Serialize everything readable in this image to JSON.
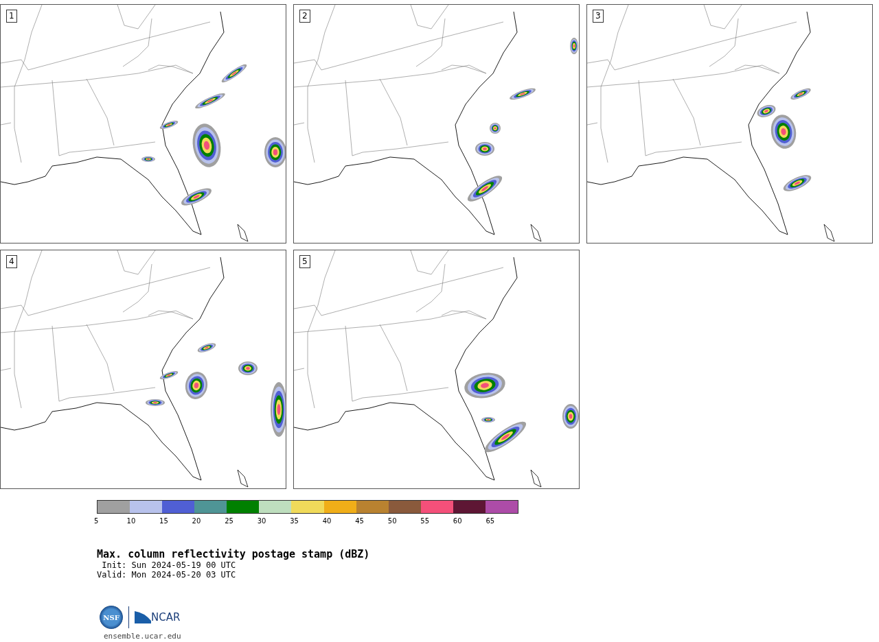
{
  "panels": [
    {
      "label": "1"
    },
    {
      "label": "2"
    },
    {
      "label": "3"
    },
    {
      "label": "4"
    },
    {
      "label": "5"
    }
  ],
  "colorbar": {
    "bins": [
      {
        "color": "#a0a0a0"
      },
      {
        "color": "#b8c2ec"
      },
      {
        "color": "#505fd4"
      },
      {
        "color": "#4f9596"
      },
      {
        "color": "#008000"
      },
      {
        "color": "#bedebe"
      },
      {
        "color": "#f0da5a"
      },
      {
        "color": "#f0ae18"
      },
      {
        "color": "#b98230"
      },
      {
        "color": "#8a5a3c"
      },
      {
        "color": "#f4507a"
      },
      {
        "color": "#5e1634"
      },
      {
        "color": "#ad4ca8"
      }
    ],
    "ticks": [
      "5",
      "10",
      "15",
      "20",
      "25",
      "30",
      "35",
      "40",
      "45",
      "50",
      "55",
      "60",
      "65"
    ]
  },
  "title": "Max. column reflectivity postage stamp (dBZ)",
  "init": " Init: Sun 2024-05-19 00 UTC",
  "valid": "Valid: Mon 2024-05-20 03 UTC",
  "logo": {
    "left": "NSF",
    "right": "NCAR"
  },
  "footer": "ensemble.ucar.edu"
}
